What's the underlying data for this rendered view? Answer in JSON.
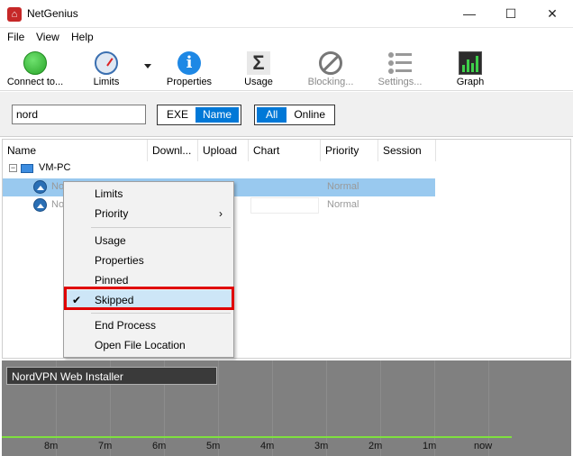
{
  "window": {
    "title": "NetGenius",
    "min_glyph": "—",
    "max_glyph": "☐",
    "close_glyph": "✕"
  },
  "menu": [
    "File",
    "View",
    "Help"
  ],
  "toolbar": {
    "connect": "Connect to...",
    "limits": "Limits",
    "properties": "Properties",
    "usage": "Usage",
    "blocking": "Blocking...",
    "settings": "Settings...",
    "graph": "Graph"
  },
  "filter": {
    "search_value": "nord",
    "mode_exe": "EXE",
    "mode_name": "Name",
    "scope_all": "All",
    "scope_online": "Online"
  },
  "columns": [
    "Name",
    "Downl...",
    "Upload",
    "Chart",
    "Priority",
    "Session"
  ],
  "tree": {
    "toggle": "−",
    "machine": "VM-PC",
    "rows": [
      {
        "name": "No",
        "priority": "Normal",
        "selected": true
      },
      {
        "name": "No",
        "priority": "Normal",
        "selected": false
      }
    ]
  },
  "context_menu": {
    "items": [
      {
        "label": "Limits"
      },
      {
        "label": "Priority",
        "submenu": "›"
      },
      {
        "label": "Usage"
      },
      {
        "label": "Properties"
      },
      {
        "label": "Pinned"
      },
      {
        "label": "Skipped",
        "checked": true,
        "check": "✔"
      },
      {
        "label": "End Process"
      },
      {
        "label": "Open File Location"
      }
    ]
  },
  "graph": {
    "title": "NordVPN Web Installer",
    "ticks": [
      "8m",
      "7m",
      "6m",
      "5m",
      "4m",
      "3m",
      "2m",
      "1m",
      "now"
    ],
    "line_color": "#7fe03f"
  },
  "colors": {
    "accent": "#0078d7",
    "selection": "#99c9ef",
    "highlight": "#e00000"
  }
}
